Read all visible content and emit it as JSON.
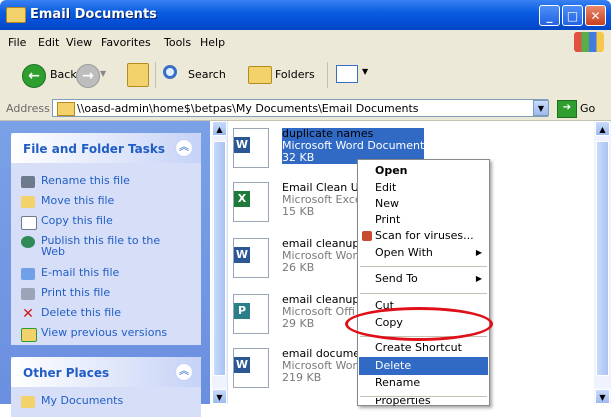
{
  "window": {
    "title": "Email Documents"
  },
  "menubar": [
    "File",
    "Edit",
    "View",
    "Favorites",
    "Tools",
    "Help"
  ],
  "toolbar": {
    "back": "Back",
    "search": "Search",
    "folders": "Folders"
  },
  "address": {
    "label": "Address",
    "path": "\\\\oasd-admin\\home$\\betpas\\My Documents\\Email Documents",
    "go": "Go"
  },
  "tasks": {
    "title": "File and Folder Tasks",
    "items": [
      {
        "label": "Rename this file",
        "icon": "rename-icon"
      },
      {
        "label": "Move this file",
        "icon": "move-icon"
      },
      {
        "label": "Copy this file",
        "icon": "copy-icon"
      },
      {
        "label": "Publish this file to the",
        "label2": "Web",
        "icon": "publish-web-icon"
      },
      {
        "label": "E-mail this file",
        "icon": "email-icon"
      },
      {
        "label": "Print this file",
        "icon": "print-icon"
      },
      {
        "label": "Delete this file",
        "icon": "delete-icon"
      },
      {
        "label": "View previous versions",
        "icon": "versions-icon"
      }
    ]
  },
  "other_places": {
    "title": "Other Places",
    "first_item": "My Documents"
  },
  "files": [
    {
      "name": "duplicate names",
      "type": "Microsoft Word Document",
      "size": "32 KB",
      "selected": true,
      "icon": "word-doc-icon"
    },
    {
      "name": "Email Clean Up",
      "type": "Microsoft Excel",
      "size": "15 KB",
      "icon": "excel-doc-icon"
    },
    {
      "name": "email cleanup",
      "type": "Microsoft Word",
      "size": "26 KB",
      "icon": "word-doc-icon"
    },
    {
      "name": "email cleanup",
      "type": "Microsoft Offi",
      "size": "29 KB",
      "icon": "publisher-doc-icon"
    },
    {
      "name": "email document",
      "type": "Microsoft Word",
      "size": "219 KB",
      "icon": "word-doc-icon"
    }
  ],
  "context_menu": {
    "open": "Open",
    "edit": "Edit",
    "new": "New",
    "print": "Print",
    "scan": "Scan for viruses...",
    "open_with": "Open With",
    "send_to": "Send To",
    "cut": "Cut",
    "copy": "Copy",
    "create_shortcut": "Create Shortcut",
    "delete": "Delete",
    "rename": "Rename",
    "properties_partial": "Properties"
  },
  "colors": {
    "title_bar": "#0a5ee0",
    "selection": "#316ac5",
    "annotation_oval": "#e0101a"
  }
}
